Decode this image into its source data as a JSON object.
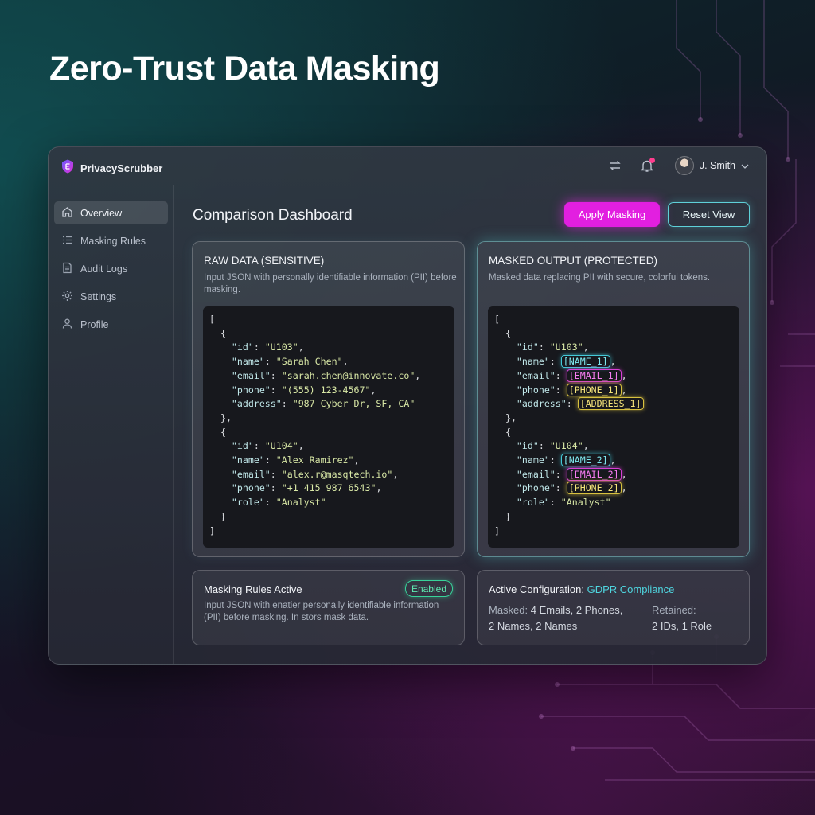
{
  "headline": "Zero-Trust Data Masking",
  "app": {
    "brand": "PrivacyScrubber",
    "user_name": "J. Smith"
  },
  "sidebar": {
    "items": [
      {
        "label": "Overview",
        "icon": "home-icon",
        "active": true
      },
      {
        "label": "Masking Rules",
        "icon": "list-icon",
        "active": false
      },
      {
        "label": "Audit Logs",
        "icon": "document-icon",
        "active": false
      },
      {
        "label": "Settings",
        "icon": "gear-icon",
        "active": false
      },
      {
        "label": "Profile",
        "icon": "user-icon",
        "active": false
      }
    ]
  },
  "main": {
    "title": "Comparison Dashboard",
    "apply_label": "Apply Masking",
    "reset_label": "Reset View"
  },
  "raw_panel": {
    "title": "RAW DATA (SENSITIVE)",
    "description": "Input JSON with personally identifiable information (PII) before masking.",
    "records": [
      {
        "id": "U103",
        "name": "Sarah Chen",
        "email": "sarah.chen@innovate.co",
        "phone": "(555) 123-4567",
        "address": "987 Cyber Dr, SF, CA"
      },
      {
        "id": "U104",
        "name": "Alex Ramirez",
        "email": "alex.r@masqtech.io",
        "phone": "+1 415 987 6543",
        "role": "Analyst"
      }
    ]
  },
  "masked_panel": {
    "title": "MASKED OUTPUT (PROTECTED)",
    "description": "Masked data replacing PII with secure, colorful tokens.",
    "records": [
      {
        "id": "U103",
        "name": "[NAME_1]",
        "email": "[EMAIL_1]",
        "phone": "[PHONE_1]",
        "address": "[ADDRESS_1]"
      },
      {
        "id": "U104",
        "name": "[NAME_2]",
        "email": "[EMAIL_2]",
        "phone": "[PHONE_2]",
        "role": "Analyst"
      }
    ]
  },
  "rules_card": {
    "title": "Masking Rules Active",
    "badge": "Enabled",
    "description": "Input JSON with enatier personally identifiable information (PII) before masking. In stors mask data."
  },
  "config_card": {
    "title_prefix": "Active Configuration:",
    "title_value": "GDPR Compliance",
    "masked_label": "Masked:",
    "masked_line1": "4 Emails, 2 Phones,",
    "masked_line2": "2 Names, 2 Names",
    "retained_label": "Retained:",
    "retained_value": "2 IDs, 1 Role"
  },
  "colors": {
    "accent_magenta": "#e21fe0",
    "accent_cyan": "#4fd6e0",
    "enabled_green": "#38d39a"
  }
}
